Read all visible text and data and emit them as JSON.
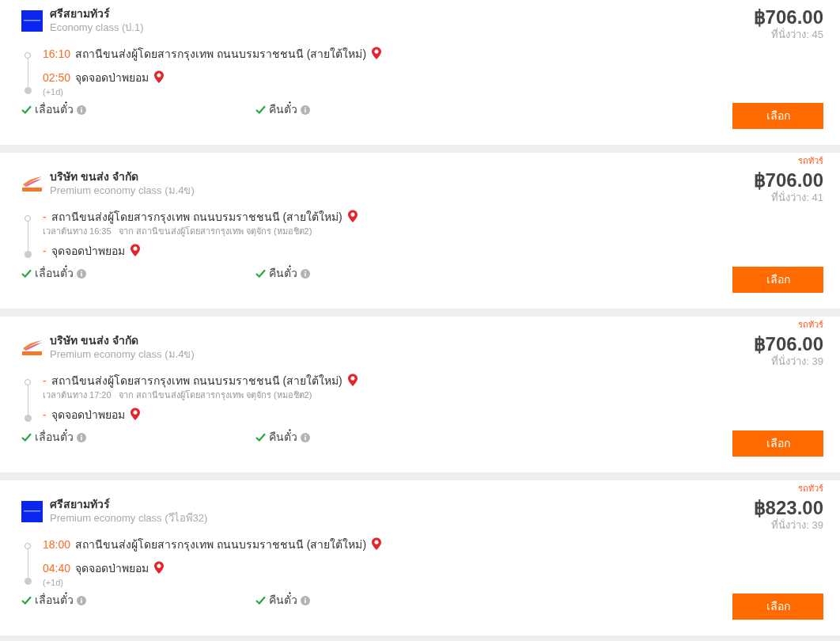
{
  "trips": [
    {
      "logo": {
        "kind": "square"
      },
      "operator": "ศรีสยามทัวร์",
      "class": "Economy class (ป.1)",
      "price": "฿706.00",
      "seats": "ที่นั่งว่าง: 45",
      "stops": [
        {
          "time": "16:10",
          "place": "สถานีขนส่งผู้โดยสารกรุงเทพ ถนนบรมราชชนนี (สายใต้ใหม่)"
        },
        {
          "time": "02:50",
          "place": "จุดจอดป่าพยอม",
          "day_offset": "(+1d)"
        }
      ],
      "features": [
        {
          "label": "เลื่อนตั๋ว",
          "available": true
        },
        {
          "label": "คืนตั๋ว",
          "available": true
        }
      ],
      "button": "เลือก"
    },
    {
      "logo": {
        "kind": "swoosh"
      },
      "tag": "รถทัวร์",
      "operator": "บริษัท ขนส่ง จำกัด",
      "class": "Premium economy class (ม.4ข)",
      "price": "฿706.00",
      "seats": "ที่นั่งว่าง: 41",
      "stops": [
        {
          "time": "-",
          "place": "สถานีขนส่งผู้โดยสารกรุงเทพ ถนนบรมราชชนนี (สายใต้ใหม่)",
          "note": "เวลาต้นทาง 16:35   จาก สถานีขนส่งผู้โดยสารกรุงเทพ จตุจักร (หมอชิต2)"
        },
        {
          "time": "-",
          "place": "จุดจอดป่าพยอม"
        }
      ],
      "features": [
        {
          "label": "เลื่อนตั๋ว",
          "available": true
        },
        {
          "label": "คืนตั๋ว",
          "available": true
        }
      ],
      "button": "เลือก"
    },
    {
      "logo": {
        "kind": "swoosh"
      },
      "tag": "รถทัวร์",
      "operator": "บริษัท ขนส่ง จำกัด",
      "class": "Premium economy class (ม.4ข)",
      "price": "฿706.00",
      "seats": "ที่นั่งว่าง: 39",
      "stops": [
        {
          "time": "-",
          "place": "สถานีขนส่งผู้โดยสารกรุงเทพ ถนนบรมราชชนนี (สายใต้ใหม่)",
          "note": "เวลาต้นทาง 17:20   จาก สถานีขนส่งผู้โดยสารกรุงเทพ จตุจักร (หมอชิต2)"
        },
        {
          "time": "-",
          "place": "จุดจอดป่าพยอม"
        }
      ],
      "features": [
        {
          "label": "เลื่อนตั๋ว",
          "available": true
        },
        {
          "label": "คืนตั๋ว",
          "available": true
        }
      ],
      "button": "เลือก"
    },
    {
      "logo": {
        "kind": "square"
      },
      "tag": "รถทัวร์",
      "operator": "ศรีสยามทัวร์",
      "class": "Premium economy class (วีไอพี32)",
      "price": "฿823.00",
      "seats": "ที่นั่งว่าง: 39",
      "stops": [
        {
          "time": "18:00",
          "place": "สถานีขนส่งผู้โดยสารกรุงเทพ ถนนบรมราชชนนี (สายใต้ใหม่)"
        },
        {
          "time": "04:40",
          "place": "จุดจอดป่าพยอม",
          "day_offset": "(+1d)"
        }
      ],
      "features": [
        {
          "label": "เลื่อนตั๋ว",
          "available": true
        },
        {
          "label": "คืนตั๋ว",
          "available": true
        }
      ],
      "button": "เลือก"
    }
  ]
}
